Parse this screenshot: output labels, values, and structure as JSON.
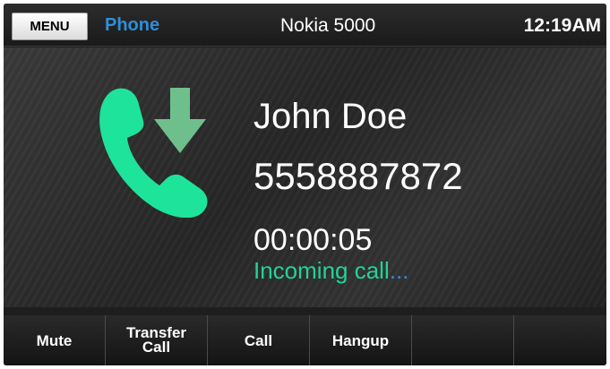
{
  "topbar": {
    "menu_label": "MENU",
    "app_title": "Phone",
    "device_name": "Nokia 5000",
    "time": "12:19AM"
  },
  "call": {
    "caller_name": "John Doe",
    "caller_number": "5558887872",
    "duration": "00:00:05",
    "status_text": "Incoming call",
    "status_dots": "...",
    "icon": "incoming-call-icon"
  },
  "softkeys": [
    {
      "label": "Mute"
    },
    {
      "label": "Transfer Call"
    },
    {
      "label": "Call"
    },
    {
      "label": "Hangup"
    },
    {
      "label": ""
    },
    {
      "label": ""
    }
  ],
  "colors": {
    "accent_blue": "#2e8fd8",
    "accent_green": "#22d39a",
    "icon_green": "#1ee39b",
    "arrow_green": "#6fbf8c"
  }
}
